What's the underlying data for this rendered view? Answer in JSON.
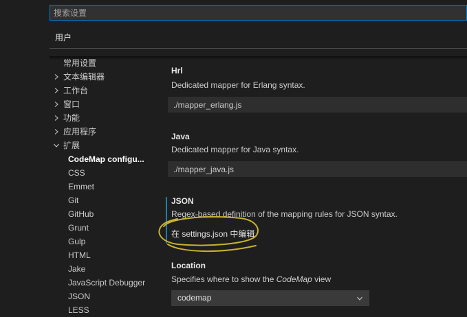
{
  "search": {
    "placeholder": "搜索设置"
  },
  "tabs": [
    {
      "label": "用户",
      "active": true
    }
  ],
  "toc": {
    "items": [
      {
        "label": "常用设置"
      },
      {
        "label": "文本编辑器",
        "icon": "chevron-right-icon",
        "expanded": false
      },
      {
        "label": "工作台",
        "icon": "chevron-right-icon",
        "expanded": false
      },
      {
        "label": "窗口",
        "icon": "chevron-right-icon",
        "expanded": false
      },
      {
        "label": "功能",
        "icon": "chevron-right-icon",
        "expanded": false
      },
      {
        "label": "应用程序",
        "icon": "chevron-right-icon",
        "expanded": false
      },
      {
        "label": "扩展",
        "icon": "chevron-down-icon",
        "expanded": true,
        "children": [
          {
            "label": "CodeMap configu...",
            "selected": true
          },
          {
            "label": "CSS"
          },
          {
            "label": "Emmet"
          },
          {
            "label": "Git"
          },
          {
            "label": "GitHub"
          },
          {
            "label": "Grunt"
          },
          {
            "label": "Gulp"
          },
          {
            "label": "HTML"
          },
          {
            "label": "Jake"
          },
          {
            "label": "JavaScript Debugger"
          },
          {
            "label": "JSON"
          },
          {
            "label": "LESS"
          }
        ]
      }
    ]
  },
  "settings": {
    "hrl": {
      "title": "Hrl",
      "description": "Dedicated mapper for Erlang syntax.",
      "value": "./mapper_erlang.js"
    },
    "java": {
      "title": "Java",
      "description": "Dedicated mapper for Java syntax.",
      "value": "./mapper_java.js"
    },
    "json": {
      "title": "JSON",
      "description": "Regex-based definition of the mapping rules for JSON syntax.",
      "edit_link": "在 settings.json 中编辑",
      "modified": true
    },
    "location": {
      "title": "Location",
      "description": {
        "before": "Specifies where to show the ",
        "emphasis": "CodeMap",
        "after": " view"
      },
      "selected": "codemap",
      "icon": "chevron-down-icon"
    }
  },
  "colors": {
    "background": "#1e1e1e",
    "accent": "#007fd4",
    "modified_indicator": "#1b80a8",
    "annotation": "#c9b22e"
  }
}
